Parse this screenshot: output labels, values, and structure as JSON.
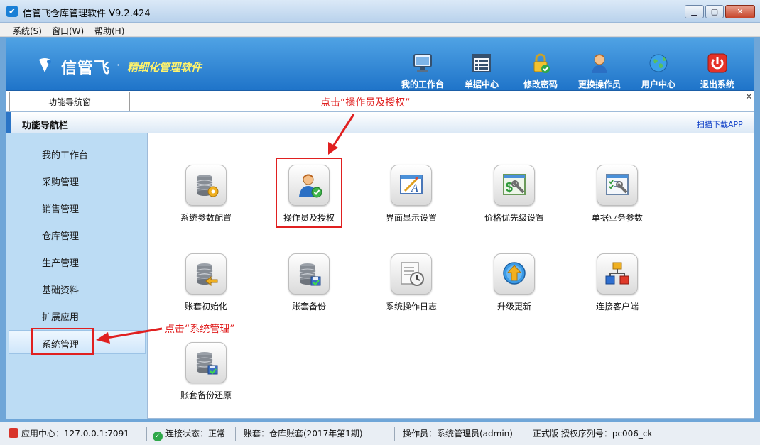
{
  "window": {
    "title": "信管飞仓库管理软件 V9.2.424",
    "app_icon_glyph": "✔"
  },
  "menubar": {
    "items": [
      "系统(S)",
      "窗口(W)",
      "帮助(H)"
    ]
  },
  "banner": {
    "brand": "信管飞",
    "dot": "·",
    "slogan": "精细化管理软件",
    "tools": [
      "我的工作台",
      "单据中心",
      "修改密码",
      "更换操作员",
      "用户中心",
      "退出系统"
    ]
  },
  "tabs": {
    "active": "功能导航窗",
    "close": "×"
  },
  "nav_header": {
    "title": "功能导航栏",
    "scan_link": "扫描下载APP"
  },
  "sidebar": {
    "items": [
      "我的工作台",
      "采购管理",
      "销售管理",
      "仓库管理",
      "生产管理",
      "基础资料",
      "扩展应用",
      "系统管理"
    ],
    "active_index": 7
  },
  "functions": [
    {
      "label": "系统参数配置",
      "icon": "database-gear-icon"
    },
    {
      "label": "操作员及授权",
      "icon": "user-check-icon"
    },
    {
      "label": "界面显示设置",
      "icon": "display-edit-icon"
    },
    {
      "label": "价格优先级设置",
      "icon": "price-tools-icon"
    },
    {
      "label": "单据业务参数",
      "icon": "document-tools-icon"
    },
    {
      "label": "账套初始化",
      "icon": "database-arrow-icon"
    },
    {
      "label": "账套备份",
      "icon": "database-backup-icon"
    },
    {
      "label": "系统操作日志",
      "icon": "log-clock-icon"
    },
    {
      "label": "升级更新",
      "icon": "upgrade-arrow-icon"
    },
    {
      "label": "连接客户端",
      "icon": "network-icon"
    },
    {
      "label": "账套备份还原",
      "icon": "database-restore-icon"
    }
  ],
  "annotations": {
    "operator": "点击“操作员及授权”",
    "system": "点击“系统管理”"
  },
  "status": {
    "app_center": "应用中心：127.0.0.1:7091",
    "connection": "连接状态：正常",
    "account": "账套：仓库账套(2017年第1期)",
    "operator": "操作员：系统管理员(admin)",
    "license": "正式版 授权序列号：pc006_ck"
  },
  "colors": {
    "banner": "#2a7fd4",
    "sidebar": "#bcdcf4",
    "annotation": "#e02020",
    "slogan": "#fff36b"
  }
}
